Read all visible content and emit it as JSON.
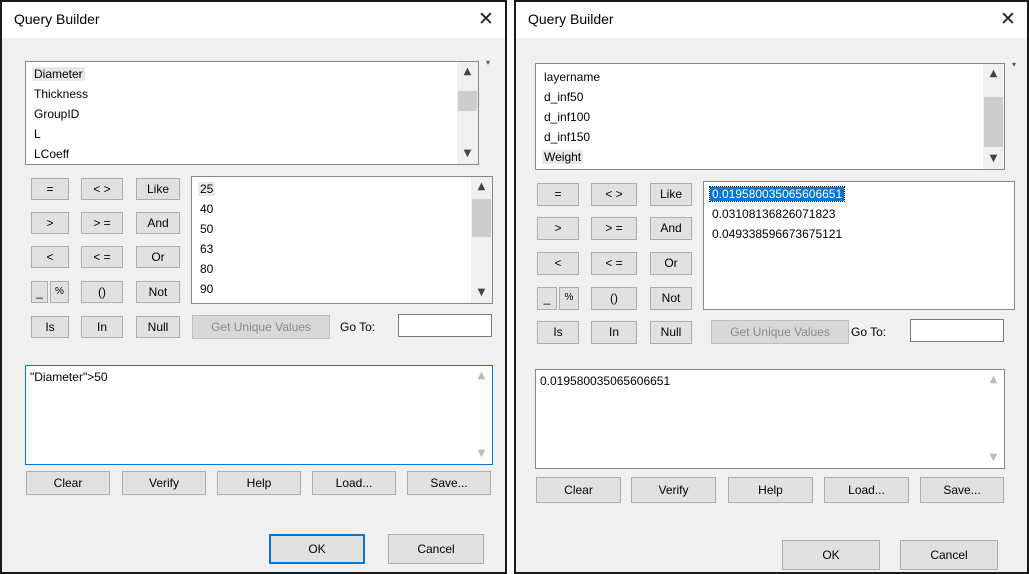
{
  "dialog1": {
    "title": "Query Builder",
    "close_glyph": "✕",
    "fields": [
      "Diameter",
      "Thickness",
      "GroupID",
      "L",
      "LCoeff"
    ],
    "values": [
      "25",
      "40",
      "50",
      "63",
      "80",
      "90"
    ],
    "expression": "\"Diameter\">50"
  },
  "dialog2": {
    "title": "Query Builder",
    "close_glyph": "✕",
    "fields": [
      "layername",
      "d_inf50",
      "d_inf100",
      "d_inf150",
      "Weight"
    ],
    "values": [
      "0.019580035065606651",
      "0.03108136826071823",
      "0.049338596673675121"
    ],
    "expression": "0.019580035065606651"
  },
  "operators": {
    "eq": "=",
    "ne": "< >",
    "like": "Like",
    "gt": ">",
    "ge": "> =",
    "and": "And",
    "lt": "<",
    "le": "< =",
    "or": "Or",
    "underscore": "_",
    "percent": "%",
    "parens": "()",
    "not": "Not",
    "is": "Is",
    "in": "In",
    "null": "Null"
  },
  "get_unique_values": "Get Unique Values",
  "goto_label": "Go To:",
  "actions": {
    "clear": "Clear",
    "verify": "Verify",
    "help": "Help",
    "load": "Load...",
    "save": "Save..."
  },
  "ok": "OK",
  "cancel": "Cancel",
  "scroll_glyphs": {
    "up": "▲",
    "down": "▼",
    "menu": "▾"
  },
  "colors": {
    "selection": "#0078d7",
    "default_button_border": "#0078d7",
    "dialog_bg": "#f0f0f0"
  }
}
